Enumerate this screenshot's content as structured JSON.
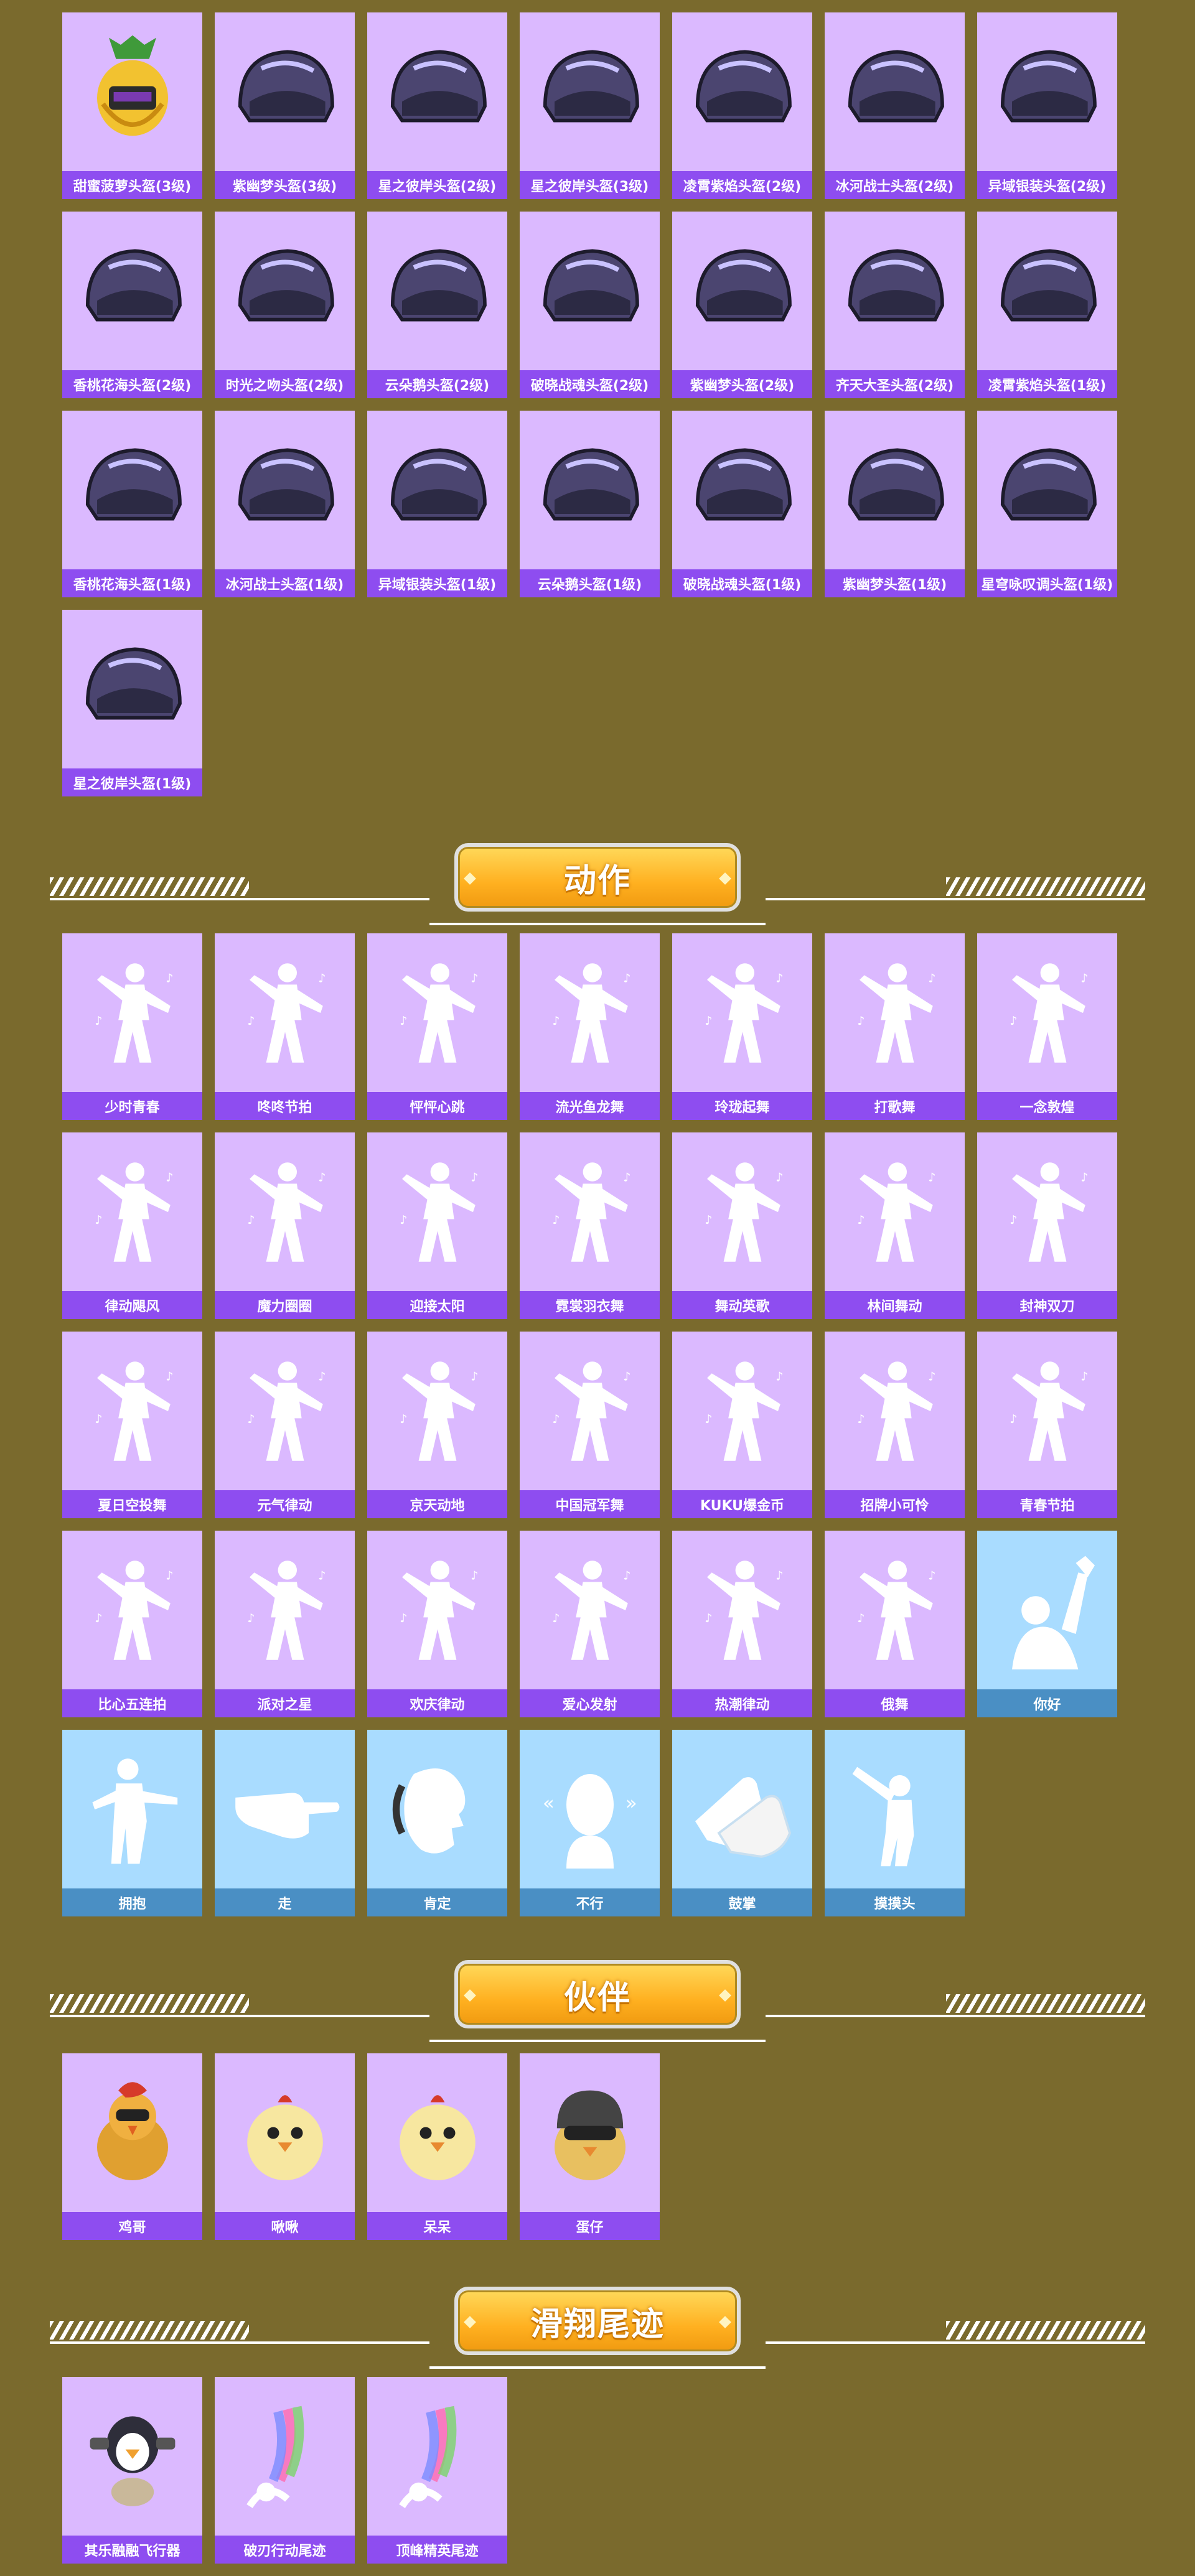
{
  "sections": [
    {
      "key": "helmets",
      "title": "",
      "items": [
        {
          "label": "甜蜜菠萝头盔(3级)",
          "icon": "pineapple-helmet-icon"
        },
        {
          "label": "紫幽梦头盔(3级)",
          "icon": "helmet-icon"
        },
        {
          "label": "星之彼岸头盔(2级)",
          "icon": "helmet-icon"
        },
        {
          "label": "星之彼岸头盔(3级)",
          "icon": "helmet-icon"
        },
        {
          "label": "凌霄紫焰头盔(2级)",
          "icon": "helmet-icon"
        },
        {
          "label": "冰河战士头盔(2级)",
          "icon": "helmet-icon"
        },
        {
          "label": "异域银装头盔(2级)",
          "icon": "helmet-icon"
        },
        {
          "label": "香桃花海头盔(2级)",
          "icon": "helmet-icon"
        },
        {
          "label": "时光之吻头盔(2级)",
          "icon": "helmet-icon"
        },
        {
          "label": "云朵鹅头盔(2级)",
          "icon": "helmet-icon"
        },
        {
          "label": "破晓战魂头盔(2级)",
          "icon": "helmet-icon"
        },
        {
          "label": "紫幽梦头盔(2级)",
          "icon": "helmet-icon"
        },
        {
          "label": "齐天大圣头盔(2级)",
          "icon": "helmet-icon"
        },
        {
          "label": "凌霄紫焰头盔(1级)",
          "icon": "helmet-icon"
        },
        {
          "label": "香桃花海头盔(1级)",
          "icon": "helmet-icon"
        },
        {
          "label": "冰河战士头盔(1级)",
          "icon": "helmet-icon"
        },
        {
          "label": "异域银装头盔(1级)",
          "icon": "helmet-icon"
        },
        {
          "label": "云朵鹅头盔(1级)",
          "icon": "helmet-icon"
        },
        {
          "label": "破晓战魂头盔(1级)",
          "icon": "helmet-icon"
        },
        {
          "label": "紫幽梦头盔(1级)",
          "icon": "helmet-icon"
        },
        {
          "label": "星穹咏叹调头盔(1级)",
          "icon": "helmet-icon"
        },
        {
          "label": "星之彼岸头盔(1级)",
          "icon": "helmet-icon"
        }
      ]
    },
    {
      "key": "actions",
      "title": "动作",
      "items": [
        {
          "label": "少时青春",
          "icon": "dance-pose-icon"
        },
        {
          "label": "咚咚节拍",
          "icon": "dance-pose-icon"
        },
        {
          "label": "怦怦心跳",
          "icon": "dance-pose-icon"
        },
        {
          "label": "流光鱼龙舞",
          "icon": "dance-pose-icon"
        },
        {
          "label": "玲珑起舞",
          "icon": "dance-pose-icon"
        },
        {
          "label": "打歌舞",
          "icon": "dance-pose-icon"
        },
        {
          "label": "一念敦煌",
          "icon": "dance-pose-icon"
        },
        {
          "label": "律动飓风",
          "icon": "dance-pose-icon"
        },
        {
          "label": "魔力圈圈",
          "icon": "dance-pose-icon"
        },
        {
          "label": "迎接太阳",
          "icon": "dance-pose-icon"
        },
        {
          "label": "霓裳羽衣舞",
          "icon": "dance-pose-icon"
        },
        {
          "label": "舞动英歌",
          "icon": "dance-pose-icon"
        },
        {
          "label": "林间舞动",
          "icon": "dance-pose-icon"
        },
        {
          "label": "封神双刀",
          "icon": "dance-pose-icon"
        },
        {
          "label": "夏日空投舞",
          "icon": "dance-pose-icon"
        },
        {
          "label": "元气律动",
          "icon": "dance-pose-icon"
        },
        {
          "label": "京天动地",
          "icon": "dance-pose-icon"
        },
        {
          "label": "中国冠军舞",
          "icon": "dance-pose-icon"
        },
        {
          "label": "KUKU爆金币",
          "icon": "dance-pose-icon"
        },
        {
          "label": "招牌小可怜",
          "icon": "dance-pose-icon"
        },
        {
          "label": "青春节拍",
          "icon": "dance-pose-icon"
        },
        {
          "label": "比心五连拍",
          "icon": "dance-pose-icon"
        },
        {
          "label": "派对之星",
          "icon": "dance-pose-icon"
        },
        {
          "label": "欢庆律动",
          "icon": "dance-pose-icon"
        },
        {
          "label": "爱心发射",
          "icon": "dance-pose-icon"
        },
        {
          "label": "热潮律动",
          "icon": "dance-pose-icon"
        },
        {
          "label": "俄舞",
          "icon": "dance-pose-icon"
        },
        {
          "label": "你好",
          "icon": "wave-pose-icon",
          "blue": true
        },
        {
          "label": "拥抱",
          "icon": "hug-pose-icon",
          "blue": true
        },
        {
          "label": "走",
          "icon": "pointing-hand-icon",
          "blue": true
        },
        {
          "label": "肯定",
          "icon": "nod-head-icon",
          "blue": true
        },
        {
          "label": "不行",
          "icon": "shake-head-icon",
          "blue": true
        },
        {
          "label": "鼓掌",
          "icon": "clapping-hands-icon",
          "blue": true
        },
        {
          "label": "摸摸头",
          "icon": "pat-head-pose-icon",
          "blue": true
        }
      ]
    },
    {
      "key": "partners",
      "title": "伙伴",
      "items": [
        {
          "label": "鸡哥",
          "icon": "rooster-icon"
        },
        {
          "label": "啾啾",
          "icon": "chick-icon"
        },
        {
          "label": "呆呆",
          "icon": "chick-icon"
        },
        {
          "label": "蛋仔",
          "icon": "chick-helmet-icon"
        }
      ]
    },
    {
      "key": "glide",
      "title": "滑翔尾迹",
      "items": [
        {
          "label": "其乐融融飞行器",
          "icon": "penguin-glider-icon"
        },
        {
          "label": "破刃行动尾迹",
          "icon": "glide-trail-icon"
        },
        {
          "label": "顶峰精英尾迹",
          "icon": "glide-trail-icon"
        }
      ]
    }
  ],
  "colors": {
    "background": "#7a6a2d",
    "card": "#dbb9ff",
    "card_label": "#8e4df0",
    "card_blue": "#a9dcff",
    "card_blue_label": "#4a8fc4",
    "banner": "#ffb020"
  }
}
